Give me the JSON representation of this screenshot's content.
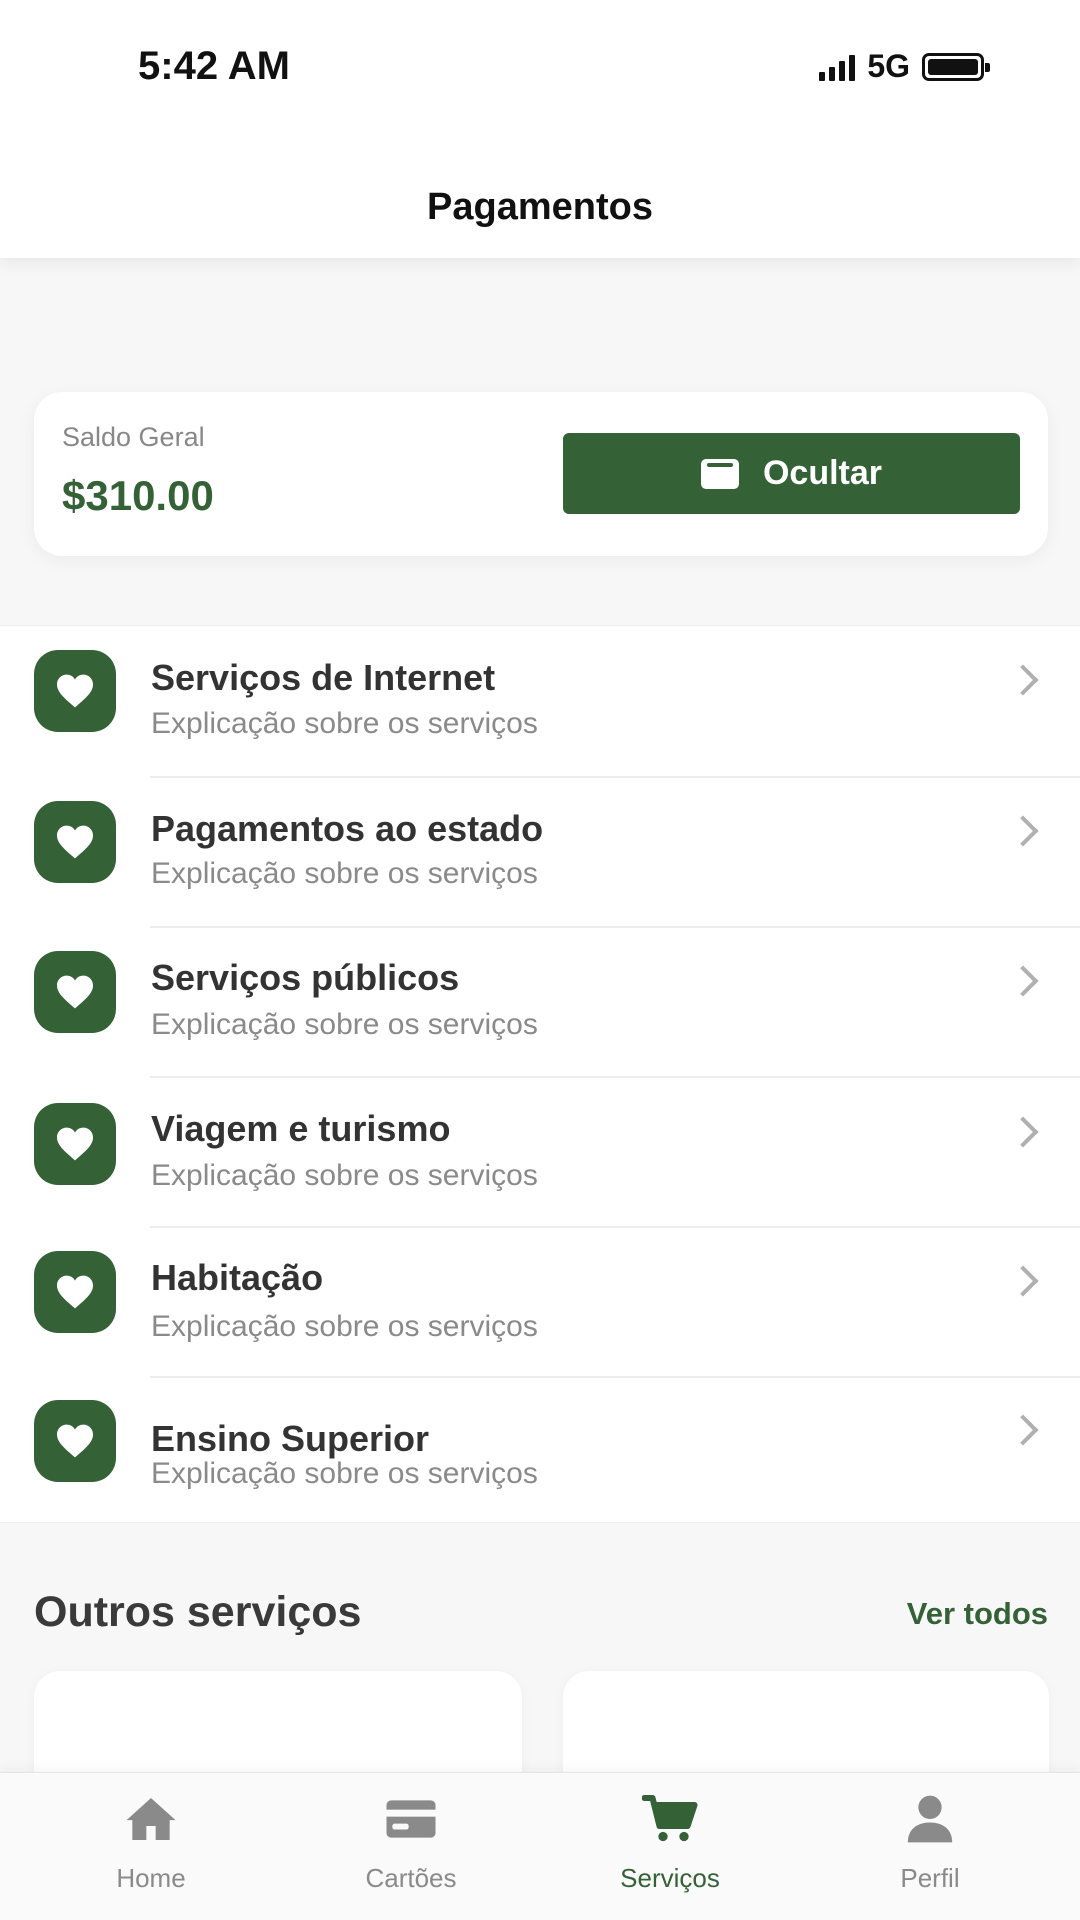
{
  "status_bar": {
    "time": "5:42 AM",
    "network": "5G"
  },
  "header": {
    "title": "Pagamentos"
  },
  "balance": {
    "label": "Saldo Geral",
    "value": "$310.00",
    "hide_button": {
      "label": "Ocultar",
      "icon": "wallet-icon"
    }
  },
  "services": {
    "icon": "heart-icon",
    "items": [
      {
        "title": "Serviços de Internet",
        "subtitle": "Explicação sobre os serviços"
      },
      {
        "title": "Pagamentos ao estado",
        "subtitle": "Explicação sobre os serviços"
      },
      {
        "title": "Serviços públicos",
        "subtitle": "Explicação sobre os serviços"
      },
      {
        "title": "Viagem e turismo",
        "subtitle": "Explicação sobre os serviços"
      },
      {
        "title": "Habitação",
        "subtitle": "Explicação sobre os serviços"
      },
      {
        "title": "Ensino Superior",
        "subtitle": "Explicação sobre os serviços"
      }
    ]
  },
  "other_services": {
    "title": "Outros serviços",
    "see_all": "Ver todos"
  },
  "bottom_nav": {
    "items": [
      {
        "label": "Home",
        "icon": "home-icon",
        "active": false
      },
      {
        "label": "Cartões",
        "icon": "card-icon",
        "active": false
      },
      {
        "label": "Serviços",
        "icon": "cart-icon",
        "active": true
      },
      {
        "label": "Perfil",
        "icon": "user-icon",
        "active": false
      }
    ]
  },
  "colors": {
    "accent": "#356137",
    "inactive": "#8a8a8a",
    "background": "#f7f7f7"
  }
}
